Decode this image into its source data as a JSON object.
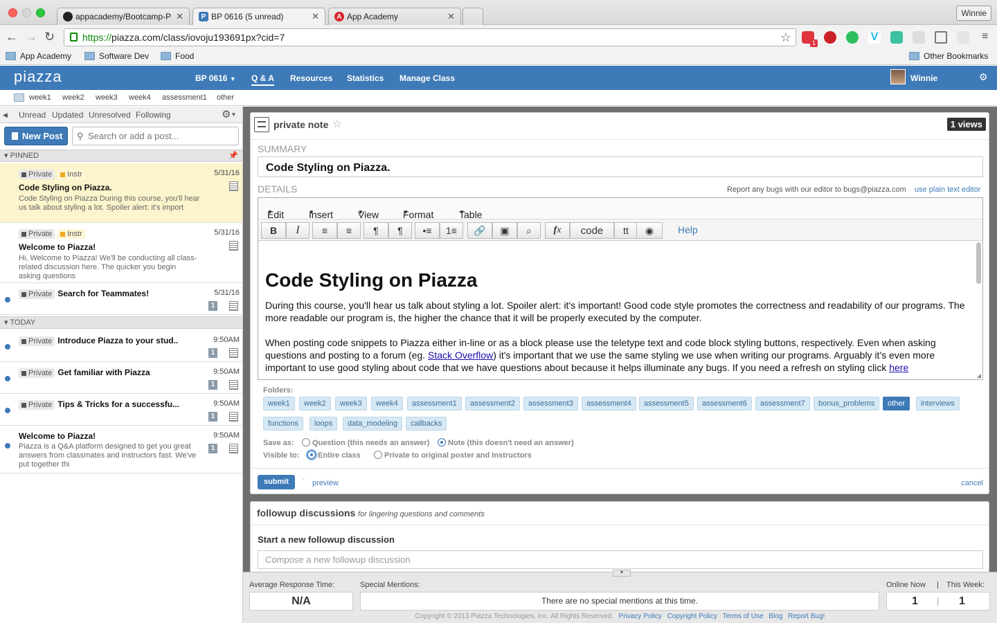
{
  "browser": {
    "tabs": [
      {
        "title": "appacademy/Bootcamp-P",
        "favicon": "github-icon"
      },
      {
        "title": "BP 0616 (5 unread)",
        "favicon": "piazza-icon"
      },
      {
        "title": "App Academy",
        "favicon": "appacademy-icon"
      }
    ],
    "profile_name": "Winnie",
    "url_scheme": "https://",
    "url_rest": "piazza.com/class/iovoju193691px?cid=7",
    "bookmarks": [
      "App Academy",
      "Software Dev",
      "Food"
    ],
    "other_bookmarks": "Other Bookmarks",
    "extension_badge": "1"
  },
  "piazza_nav": {
    "logo": "piazza",
    "class_name": "BP 0616",
    "items": [
      "Q & A",
      "Resources",
      "Statistics",
      "Manage Class"
    ],
    "user": "Winnie"
  },
  "folder_bar": [
    "week1",
    "week2",
    "week3",
    "week4",
    "assessment1",
    "other"
  ],
  "left": {
    "filters": [
      "Unread",
      "Updated",
      "Unresolved",
      "Following"
    ],
    "new_post": "New Post",
    "search_placeholder": "Search or add a post...",
    "pinned_label": "PINNED",
    "today_label": "TODAY",
    "pinned_posts": [
      {
        "tags": [
          "Private",
          "Instr"
        ],
        "date": "5/31/16",
        "title": "Code Styling on Piazza.",
        "snippet": "Code Styling on Piazza During this course, you'll hear us talk about styling a lot. Spoiler alert: it's import"
      },
      {
        "tags": [
          "Private",
          "Instr"
        ],
        "date": "5/31/16",
        "title": "Welcome to Piazza!",
        "snippet": "Hi, Welcome to Piazza! We'll be conducting all class-related discussion here. The quicker you begin asking questions"
      },
      {
        "tags": [
          "Private"
        ],
        "date": "5/31/16",
        "title": "Search for Teammates!",
        "count": "1"
      }
    ],
    "today_posts": [
      {
        "tags": [
          "Private"
        ],
        "date": "9:50AM",
        "title": "Introduce Piazza to your stud..",
        "count": "1"
      },
      {
        "tags": [
          "Private"
        ],
        "date": "9:50AM",
        "title": "Get familiar with Piazza",
        "count": "1"
      },
      {
        "tags": [
          "Private"
        ],
        "date": "9:50AM",
        "title": "Tips & Tricks for a successfu...",
        "count": "1"
      },
      {
        "tags": [],
        "date": "9:50AM",
        "title": "Welcome to Piazza!",
        "snippet": "Piazza is a Q&A platform designed to get you great answers from classmates and instructors fast. We've put together thi",
        "count": "1"
      }
    ]
  },
  "editor": {
    "note_type": "private note",
    "views": "1 views",
    "summary_label": "SUMMARY",
    "summary_value": "Code Styling on Piazza.",
    "details_label": "DETAILS",
    "bug_text": "Report any bugs with our editor to bugs@piazza.com",
    "plain_editor": "use plain text editor",
    "menus": [
      "Edit",
      "Insert",
      "View",
      "Format",
      "Table"
    ],
    "code_btn": "code",
    "tt_btn": "tt",
    "help": "Help",
    "content_heading": "Code Styling on Piazza",
    "para1": "During this course, you'll hear us talk about styling a lot. Spoiler alert: it's important! Good code style promotes the correctness and readability of our programs. The more readable our program is, the higher the chance that it will be properly executed by the computer.",
    "para2_start": "When posting code snippets to Piazza either in-line or as a block please use the teletype text and code block styling buttons, respectively.  Even when asking questions and posting to a forum (eg. ",
    "para2_link": "Stack Overflow",
    "para2_end": ") it's important that we use the same styling we use when writing our programs. Arguably it's even more important to use good styling about code that we have questions about because it helps illuminate any bugs. If you need a refresh on styling click ",
    "para2_link2": "here",
    "folders_label": "Folders:",
    "folders_row1": [
      "week1",
      "week2",
      "week3",
      "week4",
      "assessment1",
      "assessment2",
      "assessment3",
      "assessment4",
      "assessment5",
      "assessment6",
      "assessment7",
      "bonus_problems",
      "other",
      "interviews"
    ],
    "folders_row2": [
      "functions",
      "loops",
      "data_modeling",
      "callbacks"
    ],
    "selected_folder": "other",
    "save_as_label": "Save as:",
    "save_question": "Question (this needs an answer)",
    "save_note": "Note (this doesn't need an answer)",
    "visible_label": "Visible to:",
    "visible_entire": "Entire class",
    "visible_private_bold": "Private",
    "visible_private_rest": " to original poster and Instructors",
    "submit": "submit",
    "preview": "preview",
    "cancel": "cancel"
  },
  "followup": {
    "title": "followup discussions",
    "subtitle": "for lingering questions and comments",
    "start_label": "Start a new followup discussion",
    "compose_placeholder": "Compose a new followup discussion"
  },
  "stats": {
    "avg_label": "Average Response Time:",
    "avg_value": "N/A",
    "mentions_label": "Special Mentions:",
    "mentions_value": "There are no special mentions at this time.",
    "online_label": "Online Now",
    "week_label": "This Week:",
    "online_value": "1",
    "week_value": "1"
  },
  "footer": {
    "copyright": "Copyright © 2013 Piazza Technologies, Inc. All Rights Reserved.",
    "links": [
      "Privacy Policy",
      "Copyright Policy",
      "Terms of Use",
      "Blog",
      "Report Bug!"
    ]
  },
  "colors": {
    "piazza_blue": "#3e7ab8",
    "selected_post": "#fbf4cc",
    "folder_tag": "#d6e8f4"
  }
}
